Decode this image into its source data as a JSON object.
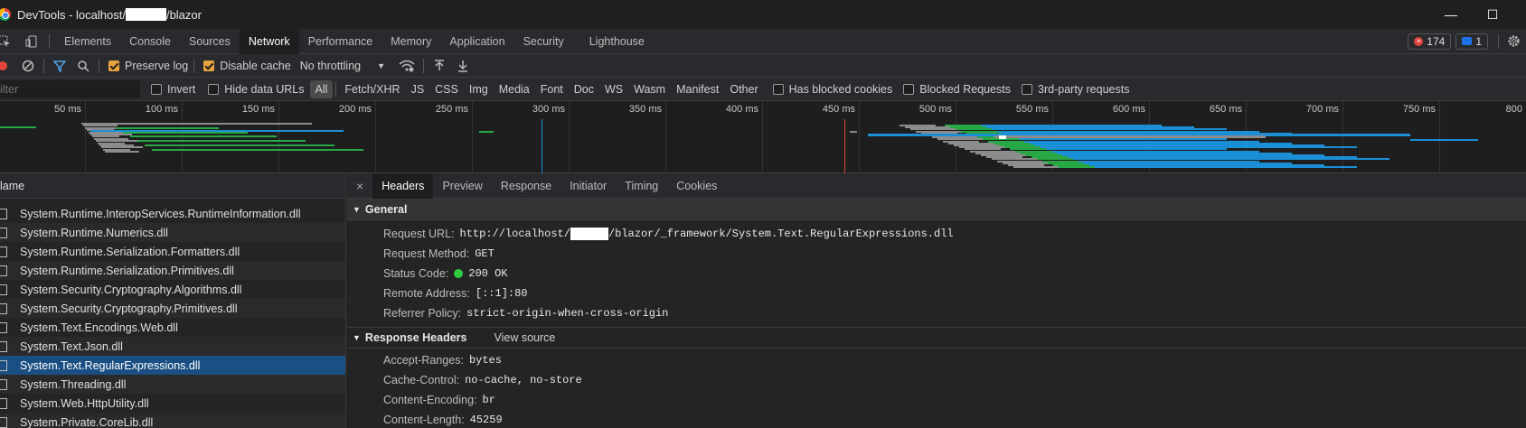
{
  "window": {
    "title_prefix": "DevTools - localhost/",
    "title_suffix": "/blazor",
    "minimize_glyph": "—",
    "maximize_glyph": "☐"
  },
  "tabs": [
    "Elements",
    "Console",
    "Sources",
    "Network",
    "Performance",
    "Memory",
    "Application",
    "Security",
    "Lighthouse"
  ],
  "active_tab": "Network",
  "badges": {
    "errors": "174",
    "messages": "1"
  },
  "toolbar": {
    "preserve_log": "Preserve log",
    "disable_cache": "Disable cache",
    "throttling": "No throttling"
  },
  "filter": {
    "placeholder": "ilter",
    "invert": "Invert",
    "hide_data_urls": "Hide data URLs",
    "types": [
      "All",
      "Fetch/XHR",
      "JS",
      "CSS",
      "Img",
      "Media",
      "Font",
      "Doc",
      "WS",
      "Wasm",
      "Manifest",
      "Other"
    ],
    "has_blocked_cookies": "Has blocked cookies",
    "blocked_requests": "Blocked Requests",
    "third_party": "3rd-party requests"
  },
  "timeline": {
    "ticks": [
      "50 ms",
      "100 ms",
      "150 ms",
      "200 ms",
      "250 ms",
      "300 ms",
      "350 ms",
      "400 ms",
      "450 ms",
      "500 ms",
      "550 ms",
      "600 ms",
      "650 ms",
      "700 ms",
      "750 ms",
      "800"
    ],
    "colors": {
      "blue": "#1a8fd6",
      "green": "#27a845",
      "gray": "#8c8c8c",
      "red": "#e0443a"
    }
  },
  "list": {
    "header": "lame",
    "rows": [
      "System.Runtime.InteropServices.RuntimeInformation.dll",
      "System.Runtime.Numerics.dll",
      "System.Runtime.Serialization.Formatters.dll",
      "System.Runtime.Serialization.Primitives.dll",
      "System.Security.Cryptography.Algorithms.dll",
      "System.Security.Cryptography.Primitives.dll",
      "System.Text.Encodings.Web.dll",
      "System.Text.Json.dll",
      "System.Text.RegularExpressions.dll",
      "System.Threading.dll",
      "System.Web.HttpUtility.dll",
      "System.Private.CoreLib.dll"
    ],
    "selected_index": 8
  },
  "detail": {
    "close_glyph": "×",
    "tabs": [
      "Headers",
      "Preview",
      "Response",
      "Initiator",
      "Timing",
      "Cookies"
    ],
    "active_tab": "Headers",
    "general_title": "General",
    "general": {
      "url_label": "Request URL:",
      "url_prefix": "http://localhost/",
      "url_suffix": "/blazor/_framework/System.Text.RegularExpressions.dll",
      "method_label": "Request Method:",
      "method": "GET",
      "status_label": "Status Code:",
      "status": "200 OK",
      "remote_label": "Remote Address:",
      "remote": "[::1]:80",
      "referrer_label": "Referrer Policy:",
      "referrer": "strict-origin-when-cross-origin"
    },
    "response_title": "Response Headers",
    "view_source": "View source",
    "response": [
      {
        "k": "Accept-Ranges:",
        "v": "bytes"
      },
      {
        "k": "Cache-Control:",
        "v": "no-cache, no-store"
      },
      {
        "k": "Content-Encoding:",
        "v": "br"
      },
      {
        "k": "Content-Length:",
        "v": "45259"
      }
    ]
  }
}
